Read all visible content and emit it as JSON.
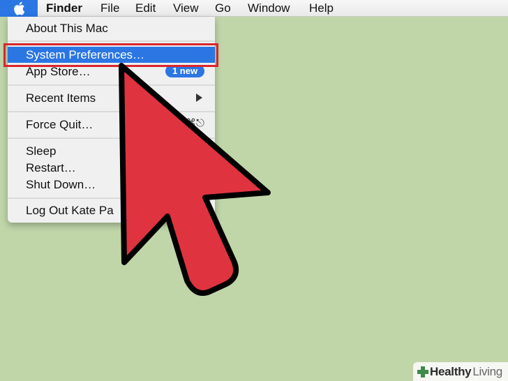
{
  "menubar": {
    "apple_icon": "apple-logo-icon",
    "items": [
      "Finder",
      "File",
      "Edit",
      "View",
      "Go",
      "Window",
      "Help"
    ]
  },
  "menu": {
    "about": "About This Mac",
    "system_preferences": "System Preferences…",
    "app_store": "App Store…",
    "app_store_badge": "1 new",
    "recent_items": "Recent Items",
    "force_quit": "Force Quit…",
    "sleep": "Sleep",
    "restart": "Restart…",
    "shut_down": "Shut Down…",
    "log_out": "Log Out Kate Pa"
  },
  "watermark": {
    "brand_bold": "Healthy",
    "brand_light": "Living"
  },
  "colors": {
    "desktop": "#c0d6a9",
    "highlight": "#2b76e3",
    "arrow_fill": "#e03340",
    "outline_red": "#d8262f"
  }
}
